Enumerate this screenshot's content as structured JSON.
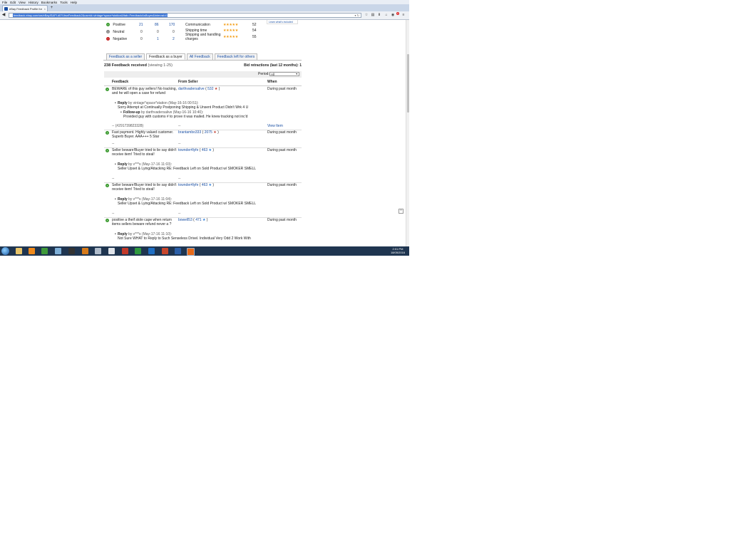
{
  "browser": {
    "menu": [
      "File",
      "Edit",
      "View",
      "History",
      "Bookmarks",
      "Tools",
      "Help"
    ],
    "tab_title": "eBay Feedback Profile for v...",
    "tab_close": "×",
    "new_tab": "+",
    "url": "feedback.ebay.com/ws/eBayISAPI.dll?ViewFeedback2&userid=vintage*space*station&ftab=FeedbackAsBuyer&interval=0"
  },
  "ratings": {
    "rows": [
      {
        "type": "Positive",
        "icon": "positive-icon",
        "m1": "21",
        "m6": "86",
        "m12": "170"
      },
      {
        "type": "Neutral",
        "icon": "neutral-icon",
        "m1": "0",
        "m6": "0",
        "m12": "0"
      },
      {
        "type": "Negative",
        "icon": "negative-icon",
        "m1": "0",
        "m6": "1",
        "m12": "2"
      }
    ],
    "dsr": [
      {
        "label": "Communication",
        "count": "52",
        "stars": "★★★★★"
      },
      {
        "label": "Shipping time",
        "count": "54",
        "stars": "★★★★★"
      },
      {
        "label": "Shipping and handling charges",
        "count": "55",
        "stars": "★★★★★"
      }
    ],
    "learn_more": "Learn what's included"
  },
  "tabs": [
    "Feedback as a seller",
    "Feedback as a buyer",
    "All Feedback",
    "Feedback left for others"
  ],
  "header": {
    "count": "238 Feedback received",
    "viewing": "(viewing 1-25)",
    "bid_retractions": "Bid retractions (last 12 months): 1"
  },
  "period": {
    "label": "Period:",
    "value": "All"
  },
  "table_head": {
    "feedback": "Feedback",
    "from": "From Seller",
    "when": "When"
  },
  "rows": [
    {
      "comment": "BEWARE of this guy sellers! No tracking, and he will open a case for refund",
      "seller": "darthvadersalive",
      "score": "532",
      "when": "During past month",
      "reply_label": "Reply",
      "reply_meta": "by vintage*space*station (May-16-16 00:51):",
      "reply_text": "Sorry Attempt at Continually Postponing Shipping & Unsent Product Didn't Wrk 4 U",
      "follow_label": "Follow-up",
      "follow_meta": "by darthvadersalive (May-16-16 10:40):",
      "follow_text": "Provided guy with customs # to prove it was mailed. He knew tracking not inc'd",
      "item": "-- (#291739823328)",
      "seller_dash": "--",
      "view_item": "View Item"
    },
    {
      "comment": "Fast payment. Highly valued customer. Superb Buyer. AAA+++ 5 Star",
      "seller": "brantambo333",
      "score": "2075",
      "when": "During past month",
      "item": "--",
      "seller_dash": "--"
    },
    {
      "comment": "Seller beware!Buyer tried to lie say didn't receive item! Tried to steal!",
      "seller": "townder4lyfe",
      "score": "463",
      "when": "During past month",
      "reply_label": "Reply",
      "reply_meta": "by v***s (May-17-16 11:03):",
      "reply_text": "Seller Upset & Lying/Attacking RE: Feedback Left on Sold Product w/ SMOKER SMELL",
      "item": "--",
      "seller_dash": "--"
    },
    {
      "comment": "Seller beware!Buyer tried to lie say didn't receive item! Tried to steal!",
      "seller": "townder4lyfe",
      "score": "463",
      "when": "During past month",
      "reply_label": "Reply",
      "reply_meta": "by v***s (May-17-16 11:04):",
      "reply_text": "Seller Upset & Lying/Attacking RE: Feedback Left on Sold Product w/ SMOKER SMELL",
      "item": "--",
      "seller_dash": "--"
    },
    {
      "comment": "positive a theif stole cape when return items sellers beware refund never a ?",
      "seller": "bowell53",
      "score": "471",
      "when": "During past month",
      "reply_label": "Reply",
      "reply_meta": "by v***s (May-17-16 11:10):",
      "reply_text": "Not Sure WHAT to Reply to Such Senseless Drivel. Individual Very Odd 2 Work With"
    }
  ],
  "taskbar": {
    "time": "2:01 PM",
    "date": "18/05/2016"
  },
  "colors": {
    "link": "#1a4fa3",
    "positive": "#3a9a2e",
    "negative": "#c62020",
    "star": "#f39c12"
  }
}
